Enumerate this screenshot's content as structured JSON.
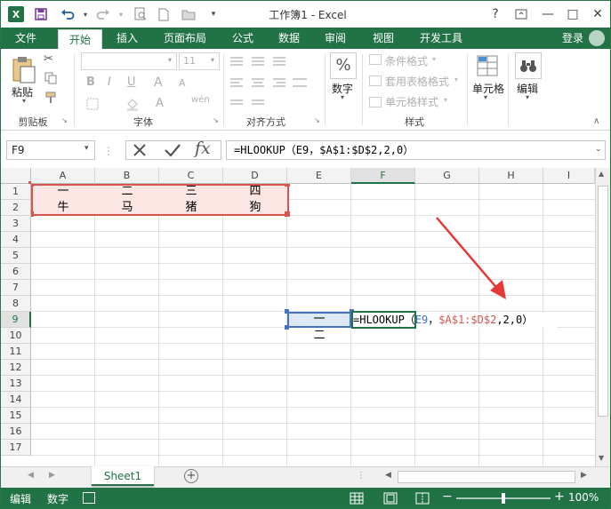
{
  "window": {
    "title": "工作簿1 - Excel",
    "help": "?",
    "restore_icon": "restore-icon",
    "minimize": "—",
    "maximize": "□",
    "close": "✕"
  },
  "qat": {
    "logo": "X",
    "save_icon": "save-icon",
    "undo_icon": "undo-icon",
    "redo_icon": "redo-icon"
  },
  "tabs": [
    "文件",
    "开始",
    "插入",
    "页面布局",
    "公式",
    "数据",
    "审阅",
    "视图",
    "开发工具"
  ],
  "active_tab": "开始",
  "account": {
    "login": "登录"
  },
  "ribbon": {
    "clipboard": {
      "paste": "粘贴",
      "label": "剪贴板"
    },
    "font": {
      "font_size": "11",
      "bold": "B",
      "italic": "I",
      "underline": "U",
      "grow": "A",
      "shrink": "A",
      "label": "字体"
    },
    "alignment": {
      "label": "对齐方式"
    },
    "number": {
      "format": "数字",
      "percent": "%"
    },
    "styles": {
      "conditional": "条件格式",
      "table": "套用表格格式",
      "cell_styles": "单元格样式",
      "label": "样式"
    },
    "cells": {
      "label": "单元格"
    },
    "editing": {
      "label": "编辑"
    }
  },
  "formula_bar": {
    "name_box": "F9",
    "fx": "fx",
    "formula": "=HLOOKUP（E9，$A$1:$D$2,2,0）"
  },
  "columns": [
    "A",
    "B",
    "C",
    "D",
    "E",
    "F",
    "G",
    "H",
    "I"
  ],
  "selected_column": "F",
  "rows": [
    "1",
    "2",
    "3",
    "4",
    "5",
    "6",
    "7",
    "8",
    "9",
    "10",
    "11",
    "12",
    "13",
    "14",
    "15",
    "16",
    "17"
  ],
  "selected_row": "9",
  "cells": {
    "A1": "一",
    "B1": "二",
    "C1": "三",
    "D1": "四",
    "A2": "牛",
    "B2": "马",
    "C2": "猪",
    "D2": "狗",
    "E9": "一",
    "E10": "二"
  },
  "f9_edit": {
    "prefix": "=HLOOKUP（",
    "arg1": "E9",
    "sep": "，",
    "arg2": "$A$1:$D$2",
    "rest": ",2,0）"
  },
  "colors": {
    "accent": "#217346",
    "range_highlight": "#d9534f",
    "e9_ref": "#4472c4",
    "arrow": "#e53935"
  },
  "sheet_tabs": [
    "Sheet1"
  ],
  "status": {
    "mode": "编辑",
    "num": "数字",
    "zoom": "100%"
  }
}
